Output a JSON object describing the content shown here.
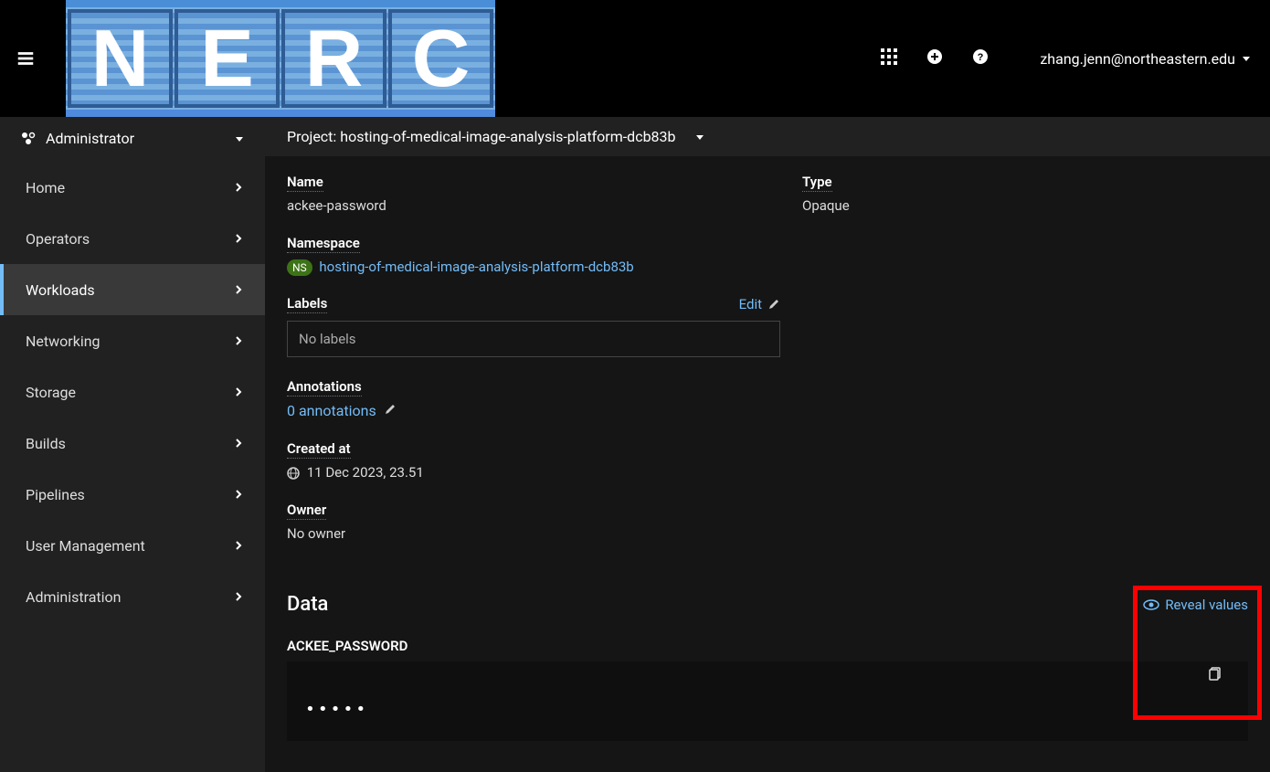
{
  "header": {
    "user_email": "zhang.jenn@northeastern.edu",
    "logo_letters": [
      "N",
      "E",
      "R",
      "C"
    ]
  },
  "sidebar": {
    "perspective": "Administrator",
    "items": [
      {
        "label": "Home",
        "active": false
      },
      {
        "label": "Operators",
        "active": false
      },
      {
        "label": "Workloads",
        "active": true
      },
      {
        "label": "Networking",
        "active": false
      },
      {
        "label": "Storage",
        "active": false
      },
      {
        "label": "Builds",
        "active": false
      },
      {
        "label": "Pipelines",
        "active": false
      },
      {
        "label": "User Management",
        "active": false
      },
      {
        "label": "Administration",
        "active": false
      }
    ]
  },
  "project_bar": {
    "prefix": "Project:",
    "name": "hosting-of-medical-image-analysis-platform-dcb83b"
  },
  "details": {
    "name_label": "Name",
    "name_value": "ackee-password",
    "type_label": "Type",
    "type_value": "Opaque",
    "namespace_label": "Namespace",
    "namespace_badge": "NS",
    "namespace_value": "hosting-of-medical-image-analysis-platform-dcb83b",
    "labels_label": "Labels",
    "labels_edit": "Edit",
    "labels_value": "No labels",
    "annotations_label": "Annotations",
    "annotations_value": "0 annotations",
    "created_label": "Created at",
    "created_value": "11 Dec 2023, 23.51",
    "owner_label": "Owner",
    "owner_value": "No owner"
  },
  "data_section": {
    "title": "Data",
    "reveal_label": "Reveal values",
    "key": "ACKEE_PASSWORD",
    "value_masked": "•••••"
  }
}
